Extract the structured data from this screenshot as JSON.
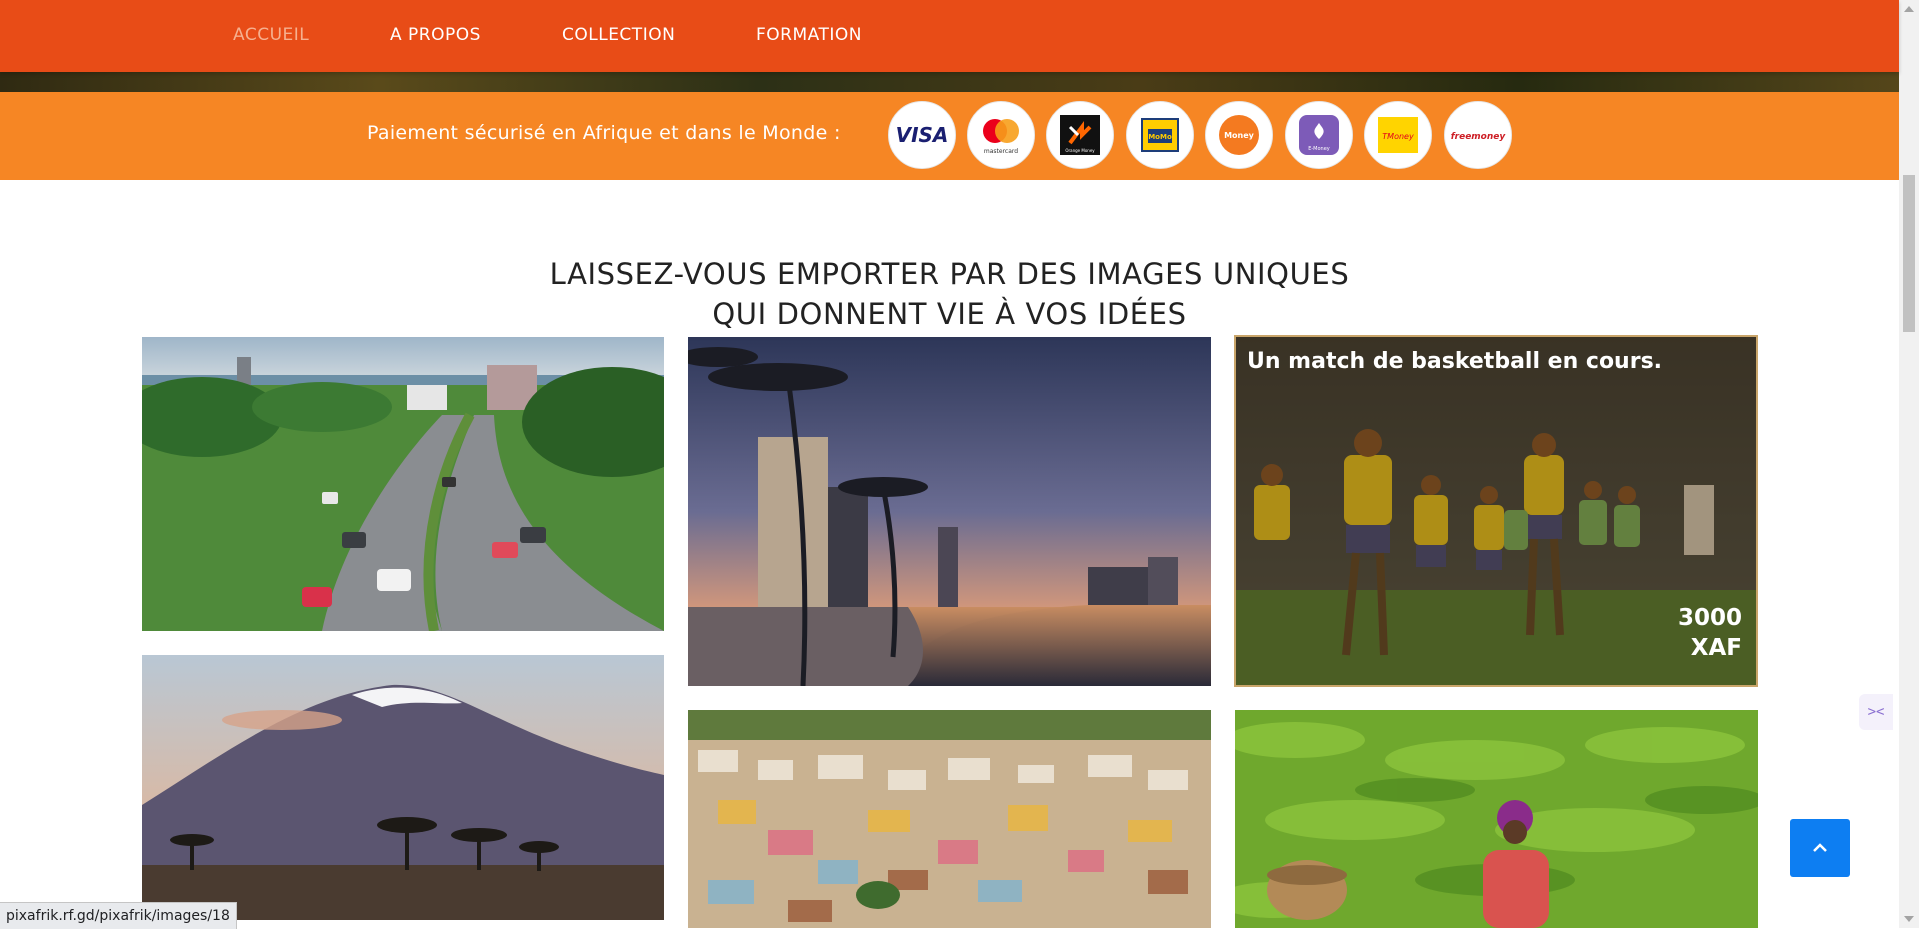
{
  "nav": {
    "items": [
      {
        "label": "ACCUEIL",
        "active": true
      },
      {
        "label": "A PROPOS",
        "active": false
      },
      {
        "label": "COLLECTION",
        "active": false
      },
      {
        "label": "FORMATION",
        "active": false
      }
    ]
  },
  "payment": {
    "label": "Paiement sécurisé en Afrique et dans le Monde :",
    "logos": [
      {
        "name": "visa",
        "text": "VISA"
      },
      {
        "name": "mastercard",
        "text": "mastercard"
      },
      {
        "name": "orange-money",
        "text": "Orange Money"
      },
      {
        "name": "mtn-momo",
        "text": "MoMo"
      },
      {
        "name": "moov-money",
        "text": "Money"
      },
      {
        "name": "e-money",
        "text": "E-Money"
      },
      {
        "name": "t-money",
        "text": "TMoney"
      },
      {
        "name": "free-money",
        "text": "freemoney"
      }
    ]
  },
  "heading": {
    "line1": "LAISSEZ-VOUS EMPORTER PAR DES IMAGES UNIQUES",
    "line2": "QUI DONNENT VIE À VOS IDÉES"
  },
  "gallery": {
    "featured": {
      "caption": "Un match de basketball en cours.",
      "price_amount": "3000",
      "price_currency": "XAF"
    }
  },
  "status_url": "pixafrik.rf.gd/pixafrik/images/18",
  "colors": {
    "nav_bg": "#e84c17",
    "pay_bg": "#f68624",
    "accent": "#0d7ef2"
  }
}
